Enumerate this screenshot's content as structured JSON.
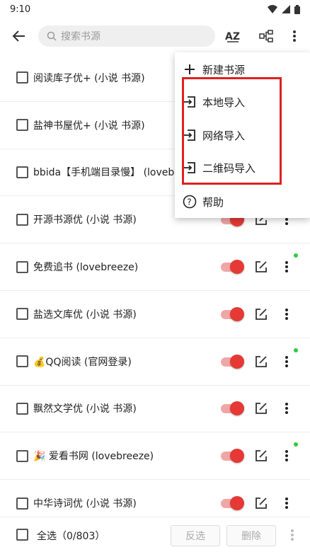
{
  "status": {
    "time": "9:10"
  },
  "app_bar": {
    "search_placeholder": "搜索书源"
  },
  "sources": [
    {
      "label": "阅读库子优+ (小说 书源)",
      "dot": false,
      "controls": false
    },
    {
      "label": "盐神书屋优+ (小说 书源)",
      "dot": false,
      "controls": false
    },
    {
      "label": "bbida【手机端目录慢】 (lovebreeze)",
      "dot": false,
      "controls": false
    },
    {
      "label": "开源书源优 (小说 书源)",
      "dot": false,
      "controls": true
    },
    {
      "label": "免费追书 (lovebreeze)",
      "dot": true,
      "controls": true
    },
    {
      "label": "盐选文库优 (小说 书源)",
      "dot": false,
      "controls": true
    },
    {
      "label": "💰QQ阅读 (官网登录)",
      "dot": true,
      "controls": true
    },
    {
      "label": "飘然文学优 (小说 书源)",
      "dot": false,
      "controls": true
    },
    {
      "label": "🎉 爱看书网 (lovebreeze)",
      "dot": true,
      "controls": true
    },
    {
      "label": "中华诗词优 (小说 书源)",
      "dot": false,
      "controls": true
    }
  ],
  "bottom_bar": {
    "select_all": "全选（0/803）",
    "invert": "反选",
    "delete": "删除"
  },
  "menu": {
    "new_source": "新建书源",
    "local_import": "本地导入",
    "network_import": "网络导入",
    "qr_import": "二维码导入",
    "help": "帮助"
  },
  "colors": {
    "accent": "#e53935",
    "highlight": "#e02020",
    "dot": "#2ecc40"
  }
}
